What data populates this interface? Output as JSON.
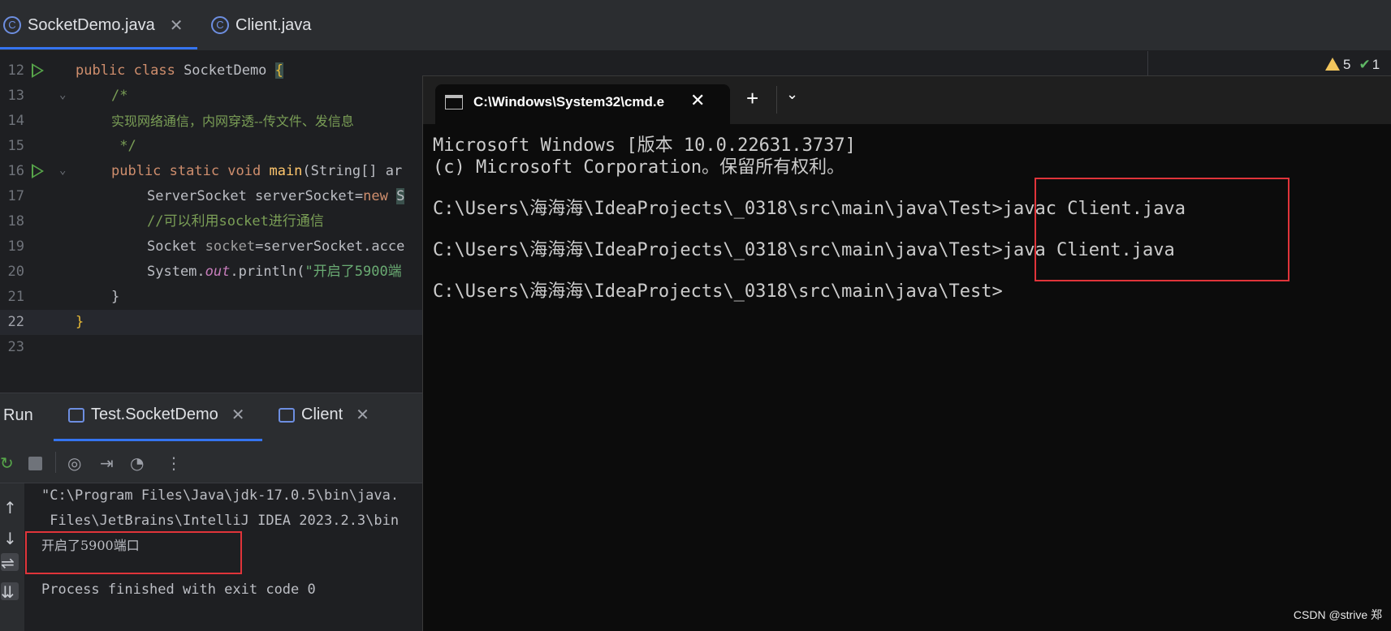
{
  "ide": {
    "tabs": [
      {
        "label": "SocketDemo.java",
        "icon": "java-class-icon",
        "active": true
      },
      {
        "label": "Client.java",
        "icon": "java-class-icon",
        "active": false
      }
    ],
    "tab_icon_letter": "C",
    "inspections": {
      "warnings": "5",
      "ok": "1"
    },
    "editor": {
      "lines": [
        {
          "num": "12"
        },
        {
          "num": "13"
        },
        {
          "num": "14"
        },
        {
          "num": "15"
        },
        {
          "num": "16"
        },
        {
          "num": "17"
        },
        {
          "num": "18"
        },
        {
          "num": "19"
        },
        {
          "num": "20"
        },
        {
          "num": "21"
        },
        {
          "num": "22"
        },
        {
          "num": "23"
        }
      ],
      "code": {
        "l12_kw": "public class ",
        "l12_cls": "SocketDemo ",
        "l12_brace": "{",
        "l13": "/*",
        "l14": "实现网络通信，内网穿透--传文件、发信息",
        "l15": " */",
        "l16_kw": "public static void ",
        "l16_fn": "main",
        "l16_rest": "(String[] ar",
        "l17_a": "ServerSocket serverSocket=",
        "l17_kw": "new ",
        "l17_b": "S",
        "l18": "//可以利用socket进行通信",
        "l19_a": "Socket ",
        "l19_var": "socket",
        "l19_b": "=serverSocket.acce",
        "l20_a": "System.",
        "l20_fld": "out",
        "l20_b": ".println(",
        "l20_str": "\"开启了5900端",
        "l21": "}",
        "l22": "}"
      }
    }
  },
  "run_panel": {
    "title": "Run",
    "tabs": [
      {
        "label": "Test.SocketDemo"
      },
      {
        "label": "Client"
      }
    ],
    "console": [
      "\"C:\\Program Files\\Java\\jdk-17.0.5\\bin\\java.",
      " Files\\JetBrains\\IntelliJ IDEA 2023.2.3\\bin",
      "开启了5900端口",
      "",
      "Process finished with exit code 0"
    ]
  },
  "cmd": {
    "tab_title": "C:\\Windows\\System32\\cmd.e",
    "lines": [
      "Microsoft Windows [版本 10.0.22631.3737]",
      "(c) Microsoft Corporation。保留所有权利。",
      "",
      "C:\\Users\\海海海\\IdeaProjects\\_0318\\src\\main\\java\\Test>javac Client.java",
      "",
      "C:\\Users\\海海海\\IdeaProjects\\_0318\\src\\main\\java\\Test>java Client.java",
      "",
      "C:\\Users\\海海海\\IdeaProjects\\_0318\\src\\main\\java\\Test>"
    ]
  },
  "watermark": "CSDN @strive 郑",
  "colors": {
    "highlight_box": "#e0343a",
    "accent": "#3574f0"
  }
}
